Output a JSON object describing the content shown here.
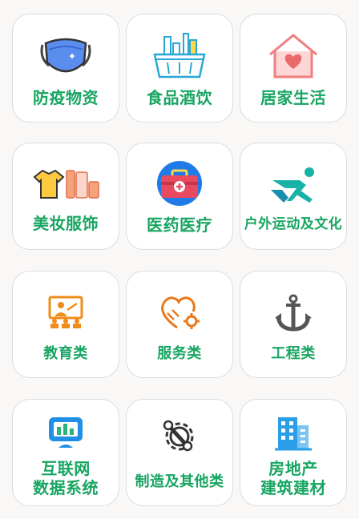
{
  "categories": [
    {
      "label": "防疫物资",
      "icon": "face-mask-icon"
    },
    {
      "label": "食品酒饮",
      "icon": "shopping-basket-icon"
    },
    {
      "label": "居家生活",
      "icon": "house-heart-icon"
    },
    {
      "label": "美妆服饰",
      "icon": "clothes-cosmetics-icon"
    },
    {
      "label": "医药医疗",
      "icon": "medical-kit-icon"
    },
    {
      "label": "户外运动及文化",
      "icon": "running-person-icon"
    },
    {
      "label": "教育类",
      "icon": "classroom-teacher-icon"
    },
    {
      "label": "服务类",
      "icon": "heart-gear-icon"
    },
    {
      "label": "工程类",
      "icon": "anchor-icon"
    },
    {
      "label_line1": "互联网",
      "label_line2": "数据系统",
      "icon": "data-monitor-icon"
    },
    {
      "label": "制造及其他类",
      "icon": "wrench-gear-icon"
    },
    {
      "label_line1": "房地产",
      "label_line2": "建筑建材",
      "icon": "building-icon"
    }
  ],
  "colors": {
    "label": "#17a561",
    "card_border": "#dcdcdc",
    "background": "#faf8f7"
  }
}
